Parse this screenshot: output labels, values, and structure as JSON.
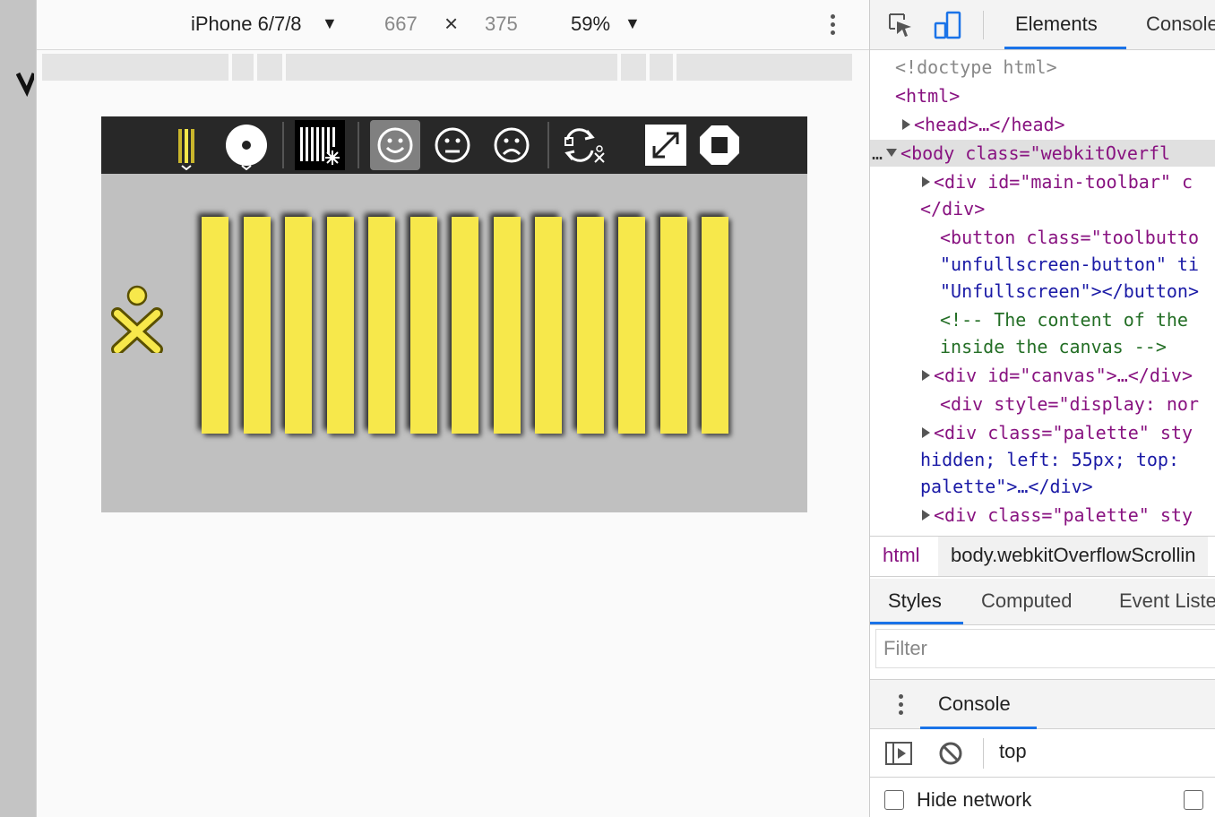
{
  "device_toolbar": {
    "device_name": "iPhone 6/7/8",
    "width": "667",
    "times": "×",
    "height": "375",
    "zoom": "59%"
  },
  "activity": {
    "toolbar_icons": [
      "pencil-bars-icon",
      "dot-circle-icon",
      "barcode-sparkle-icon",
      "smile-face-icon",
      "neutral-face-icon",
      "sad-face-icon",
      "sync-xo-icon",
      "expand-icon",
      "stop-icon"
    ],
    "selected_tool": "smile-face-icon",
    "bar_count": 13,
    "bar_color": "#f7e84b",
    "xo_color": "#f7e84b"
  },
  "devtools": {
    "tabs": [
      "Elements",
      "Console"
    ],
    "active_tab": "Elements",
    "dom": [
      {
        "text": "<!doctype html>"
      },
      {
        "text": "<html>"
      },
      {
        "text": "<head>…</head>"
      },
      {
        "text": "<body class=\"webkitOverfl"
      },
      {
        "text": "<div id=\"main-toolbar\" c"
      },
      {
        "text": "</div>"
      },
      {
        "text": "<button class=\"toolbutto"
      },
      {
        "text": "\"unfullscreen-button\" ti"
      },
      {
        "text": "\"Unfullscreen\"></button>"
      },
      {
        "text": "<!-- The content of the"
      },
      {
        "text": "inside the canvas -->"
      },
      {
        "text": "<div id=\"canvas\">…</div>"
      },
      {
        "text": "<div style=\"display: nor"
      },
      {
        "text": "<div class=\"palette\" sty"
      },
      {
        "text": "hidden; left: 55px; top:"
      },
      {
        "text": "palette\">…</div>"
      },
      {
        "text": "<div class=\"palette\" sty"
      }
    ],
    "breadcrumbs": [
      "html",
      "body.webkitOverflowScrollin"
    ],
    "styles_tabs": [
      "Styles",
      "Computed",
      "Event Liste"
    ],
    "filter_placeholder": "Filter",
    "drawer_tab": "Console",
    "context": "top",
    "hide_network": "Hide network"
  }
}
